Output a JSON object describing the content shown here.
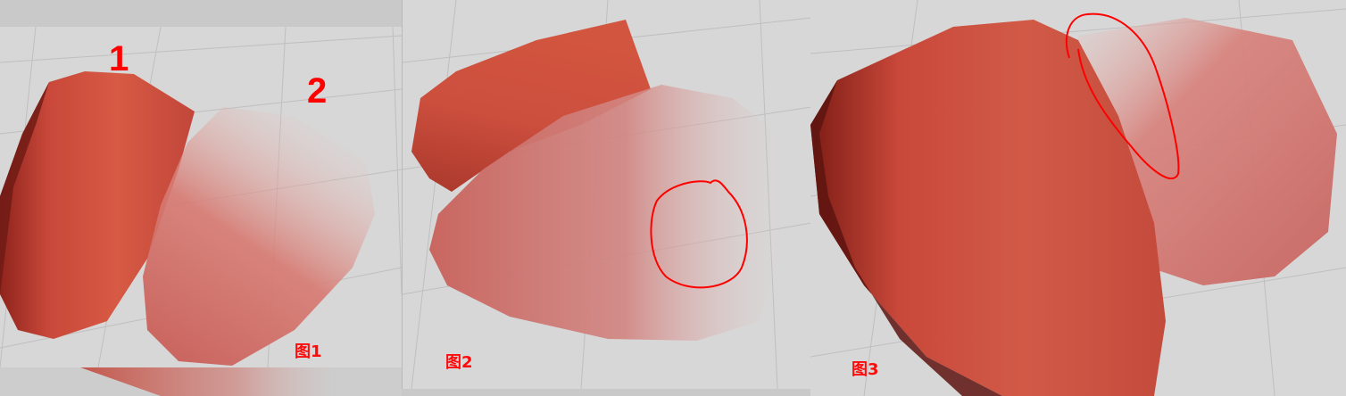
{
  "figures": [
    {
      "caption": "图1",
      "markers": [
        "1",
        "2"
      ]
    },
    {
      "caption": "图2"
    },
    {
      "caption": "图3"
    }
  ],
  "colors": {
    "background": "#d7d7d7",
    "grid": "#bdbdbd",
    "opaque_mesh": "#cc4a3b",
    "transparent_mesh": "#c9635d",
    "annotation": "#ff0000"
  }
}
